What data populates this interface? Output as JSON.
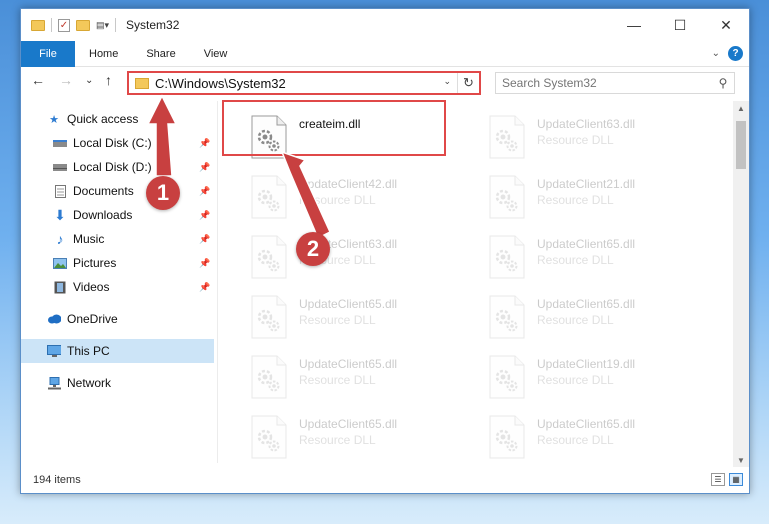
{
  "window": {
    "title": "System32",
    "controls": {
      "minimize": "—",
      "maximize": "☐",
      "close": "✕"
    }
  },
  "ribbon": {
    "tabs": [
      "File",
      "Home",
      "Share",
      "View"
    ],
    "help_label": "?"
  },
  "nav": {
    "back": "←",
    "forward": "→",
    "recent": "⌄",
    "up": "↑",
    "address": "C:\\Windows\\System32",
    "search_placeholder": "Search System32"
  },
  "sidebar": {
    "items": [
      {
        "label": "Quick access",
        "icon": "star-icon",
        "pinned": false
      },
      {
        "label": "Local Disk (C:)",
        "icon": "drive-icon",
        "pinned": true
      },
      {
        "label": "Local Disk (D:)",
        "icon": "drive-icon",
        "pinned": true
      },
      {
        "label": "Documents",
        "icon": "documents-icon",
        "pinned": true
      },
      {
        "label": "Downloads",
        "icon": "download-icon",
        "pinned": true
      },
      {
        "label": "Music",
        "icon": "music-icon",
        "pinned": true
      },
      {
        "label": "Pictures",
        "icon": "pictures-icon",
        "pinned": true
      },
      {
        "label": "Videos",
        "icon": "videos-icon",
        "pinned": true
      },
      {
        "label": "OneDrive",
        "icon": "cloud-icon",
        "pinned": false
      },
      {
        "label": "This PC",
        "icon": "computer-icon",
        "pinned": false,
        "selected": true
      },
      {
        "label": "Network",
        "icon": "network-icon",
        "pinned": false
      }
    ]
  },
  "files": [
    {
      "name": "createim.dll",
      "type": "",
      "faded": false
    },
    {
      "name": "UpdateClient63.dll",
      "type": "Resource DLL",
      "faded": true
    },
    {
      "name": "UpdateClient42.dll",
      "type": "Resource DLL",
      "faded": true
    },
    {
      "name": "UpdateClient21.dll",
      "type": "Resource DLL",
      "faded": true
    },
    {
      "name": "UpdateClient63.dll",
      "type": "Resource DLL",
      "faded": true
    },
    {
      "name": "UpdateClient65.dll",
      "type": "Resource DLL",
      "faded": true
    },
    {
      "name": "UpdateClient65.dll",
      "type": "Resource DLL",
      "faded": true
    },
    {
      "name": "UpdateClient65.dll",
      "type": "Resource DLL",
      "faded": true
    },
    {
      "name": "UpdateClient65.dll",
      "type": "Resource DLL",
      "faded": true
    },
    {
      "name": "UpdateClient19.dll",
      "type": "Resource DLL",
      "faded": true
    },
    {
      "name": "UpdateClient65.dll",
      "type": "Resource DLL",
      "faded": true
    },
    {
      "name": "UpdateClient65.dll",
      "type": "Resource DLL",
      "faded": true
    }
  ],
  "status": {
    "item_count": "194 items"
  },
  "annotations": {
    "step1": "1",
    "step2": "2",
    "color": "#c84040"
  }
}
